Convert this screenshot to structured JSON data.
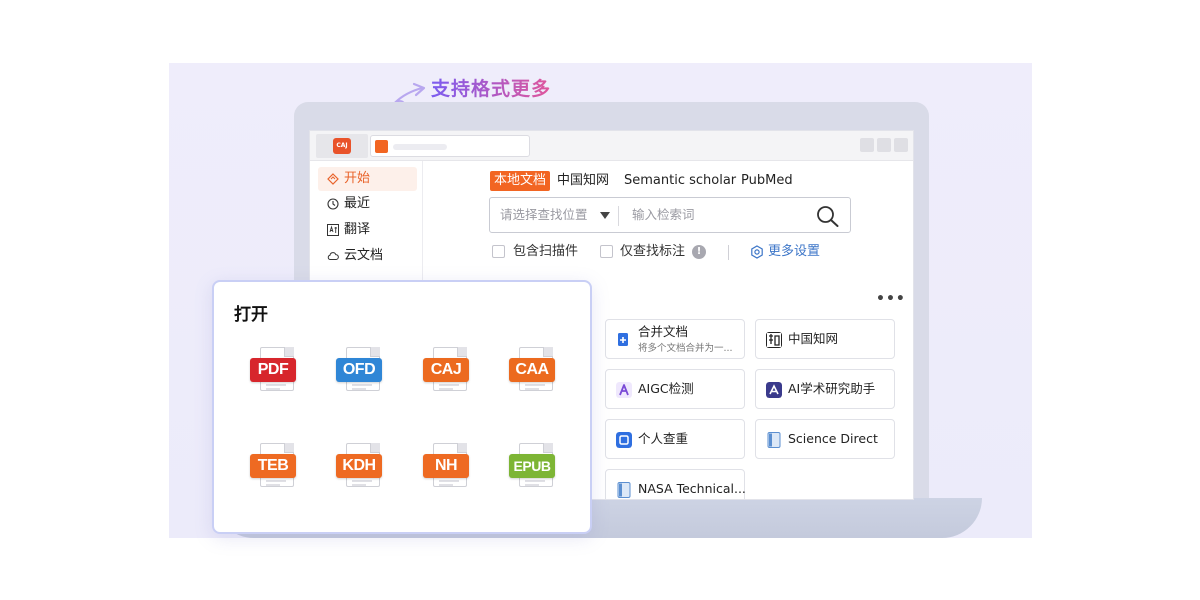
{
  "headline": "支持格式更多",
  "colors": {
    "accent": "#f26522",
    "link": "#3d76c8",
    "panel_border": "#c9cff5"
  },
  "titlebar": {
    "app_logo": "CAJ"
  },
  "sidebar": {
    "items": [
      {
        "label": "开始",
        "icon": "diamond-icon",
        "active": true
      },
      {
        "label": "最近",
        "icon": "clock-icon"
      },
      {
        "label": "翻译",
        "icon": "translate-icon"
      },
      {
        "label": "云文档",
        "icon": "cloud-icon"
      }
    ]
  },
  "search": {
    "tabs": [
      "本地文档",
      "中国知网",
      "Semantic scholar",
      "PubMed"
    ],
    "location_placeholder": "请选择查找位置",
    "query_placeholder": "输入检索词",
    "include_scanned": "包含扫描件",
    "only_annotations": "仅查找标注",
    "info_glyph": "!",
    "more_settings": "更多设置"
  },
  "tools": {
    "more": "•••",
    "cards": [
      {
        "name": "合并文档",
        "sub": "将多个文档合并为一...",
        "icon": "merge-icon",
        "color": "#2f6fe0"
      },
      {
        "name": "中国知网",
        "icon": "cnki-icon",
        "color": "#222222"
      },
      {
        "name": "AIGC检测",
        "icon": "aigc-icon",
        "color": "#7a4bd6"
      },
      {
        "name": "AI学术研究助手",
        "icon": "ai-assistant-icon",
        "color": "#3a3a8c"
      },
      {
        "name": "个人查重",
        "icon": "plagiarism-icon",
        "color": "#2f6fe0"
      },
      {
        "name": "Science Direct",
        "icon": "book-icon",
        "color": "#5b8fd0"
      },
      {
        "name": "NASA Technical...",
        "icon": "book-icon",
        "color": "#5b8fd0"
      }
    ]
  },
  "open_panel": {
    "title": "打开",
    "formats": [
      {
        "label": "PDF",
        "color": "#d7262c"
      },
      {
        "label": "OFD",
        "color": "#2f86d6"
      },
      {
        "label": "CAJ",
        "color": "#ec6a1f"
      },
      {
        "label": "CAA",
        "color": "#ec6a1f"
      },
      {
        "label": "TEB",
        "color": "#ee6a22"
      },
      {
        "label": "KDH",
        "color": "#ee6a22"
      },
      {
        "label": "NH",
        "color": "#ee6a22"
      },
      {
        "label": "EPUB",
        "color": "#7db535"
      }
    ]
  }
}
